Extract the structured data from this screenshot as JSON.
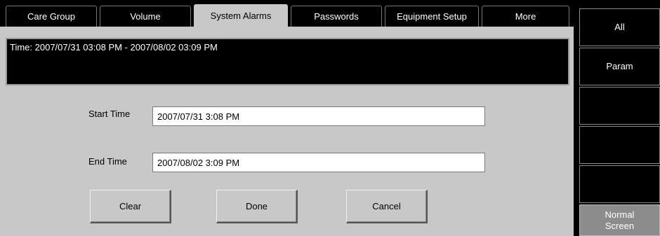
{
  "tabs": [
    {
      "label": "Care Group"
    },
    {
      "label": "Volume"
    },
    {
      "label": "System Alarms"
    },
    {
      "label": "Passwords"
    },
    {
      "label": "Equipment Setup"
    },
    {
      "label": "More"
    }
  ],
  "active_tab": "System Alarms",
  "time_banner": "Time: 2007/07/31  03:08 PM  -  2007/08/02  03:09 PM",
  "form": {
    "start_label": "Start Time",
    "start_value": "2007/07/31  3:08 PM",
    "end_label": "End Time",
    "end_value": "2007/08/02  3:09 PM"
  },
  "buttons": {
    "clear": "Clear",
    "done": "Done",
    "cancel": "Cancel"
  },
  "side_menu": {
    "all": "All",
    "param": "Param",
    "normal_screen_line1": "Normal",
    "normal_screen_line2": "Screen"
  }
}
